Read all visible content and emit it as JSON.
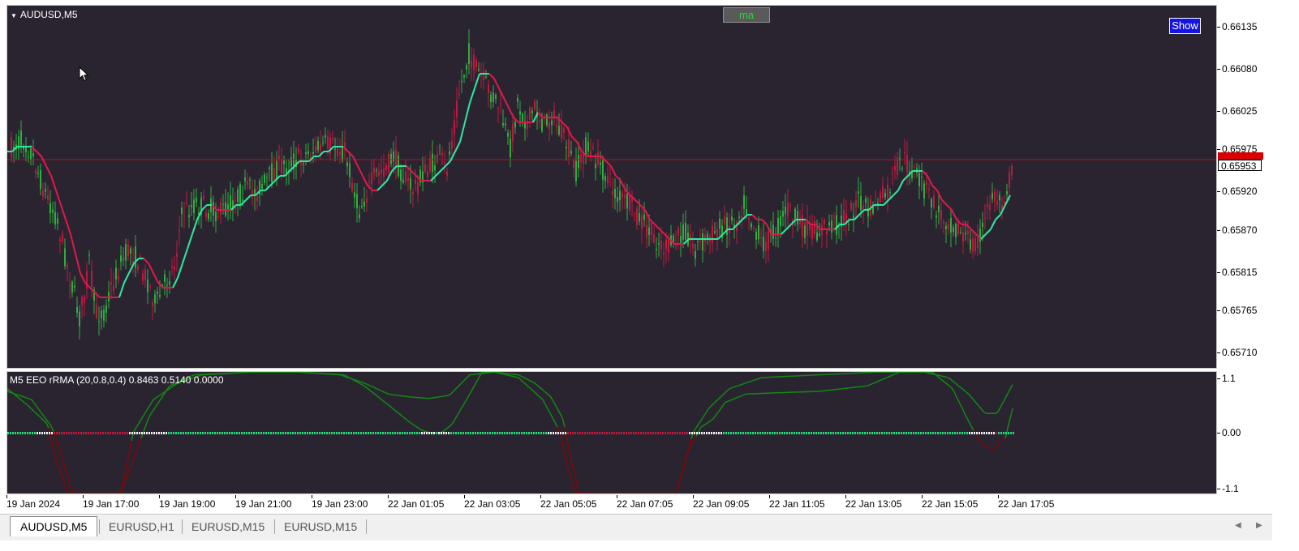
{
  "main_chart": {
    "symbol_label": "AUDUSD,M5",
    "ma_button": "ma",
    "show_button": "Show",
    "current_price": "0.65953",
    "price_ticks": [
      "0.66135",
      "0.66080",
      "0.66025",
      "0.65975",
      "0.65920",
      "0.65870",
      "0.65815",
      "0.65765",
      "0.65710"
    ]
  },
  "indicator": {
    "label": "M5 EEO rRMA (20,0.8,0.4) 0.8463 0.5140 0.0000",
    "ticks": [
      "1.1",
      "0.00",
      "-1.1"
    ]
  },
  "time_axis": [
    "19 Jan 2024",
    "19 Jan 17:00",
    "19 Jan 19:00",
    "19 Jan 21:00",
    "19 Jan 23:00",
    "22 Jan 01:05",
    "22 Jan 03:05",
    "22 Jan 05:05",
    "22 Jan 07:05",
    "22 Jan 09:05",
    "22 Jan 11:05",
    "22 Jan 13:05",
    "22 Jan 15:05",
    "22 Jan 17:05"
  ],
  "tabs": [
    "AUDUSD,M5",
    "EURUSD,H1",
    "EURUSD,M15",
    "EURUSD,M15"
  ],
  "colors": {
    "pane_bg": "#2a2431",
    "bull": "#2fae3f",
    "bear": "#c0183e",
    "ma_up": "#2ee8a0",
    "ma_down": "#e0184a",
    "ind_green": "#118a11",
    "ind_red": "#7a0a0a"
  },
  "icons": [
    "dropdown-triangle-icon",
    "mouse-cursor-icon",
    "scroll-left-icon",
    "scroll-right-icon"
  ]
}
